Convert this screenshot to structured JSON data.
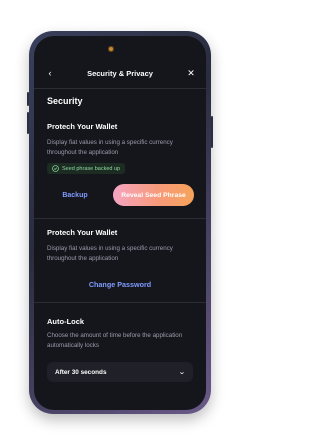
{
  "header": {
    "title": "Security & Privacy",
    "back_icon": "chevron-left-icon",
    "close_icon": "close-icon"
  },
  "page": {
    "section_title": "Security"
  },
  "seed_card": {
    "title": "Protech Your Wallet",
    "description": "Display fiat values in using a specific currency throughout the application",
    "badge_label": "Seed phrase backed up",
    "badge_icon": "check-circle-icon",
    "backup_label": "Backup",
    "reveal_label": "Reveal Seed Phrase"
  },
  "password_card": {
    "title": "Protech Your Wallet",
    "description": "Display fiat values in using a specific currency throughout the application",
    "change_label": "Change Password"
  },
  "auto_lock": {
    "title": "Auto-Lock",
    "description": "Choose the amount of time before the application automatically locks",
    "selected": "After 30 seconds",
    "chevron_icon": "chevron-down-icon"
  },
  "colors": {
    "background": "#15161c",
    "accent_link": "#7f9cff",
    "gradient_start": "#f6a5c3",
    "gradient_end": "#f6a35a",
    "success": "#8fd9a0"
  }
}
